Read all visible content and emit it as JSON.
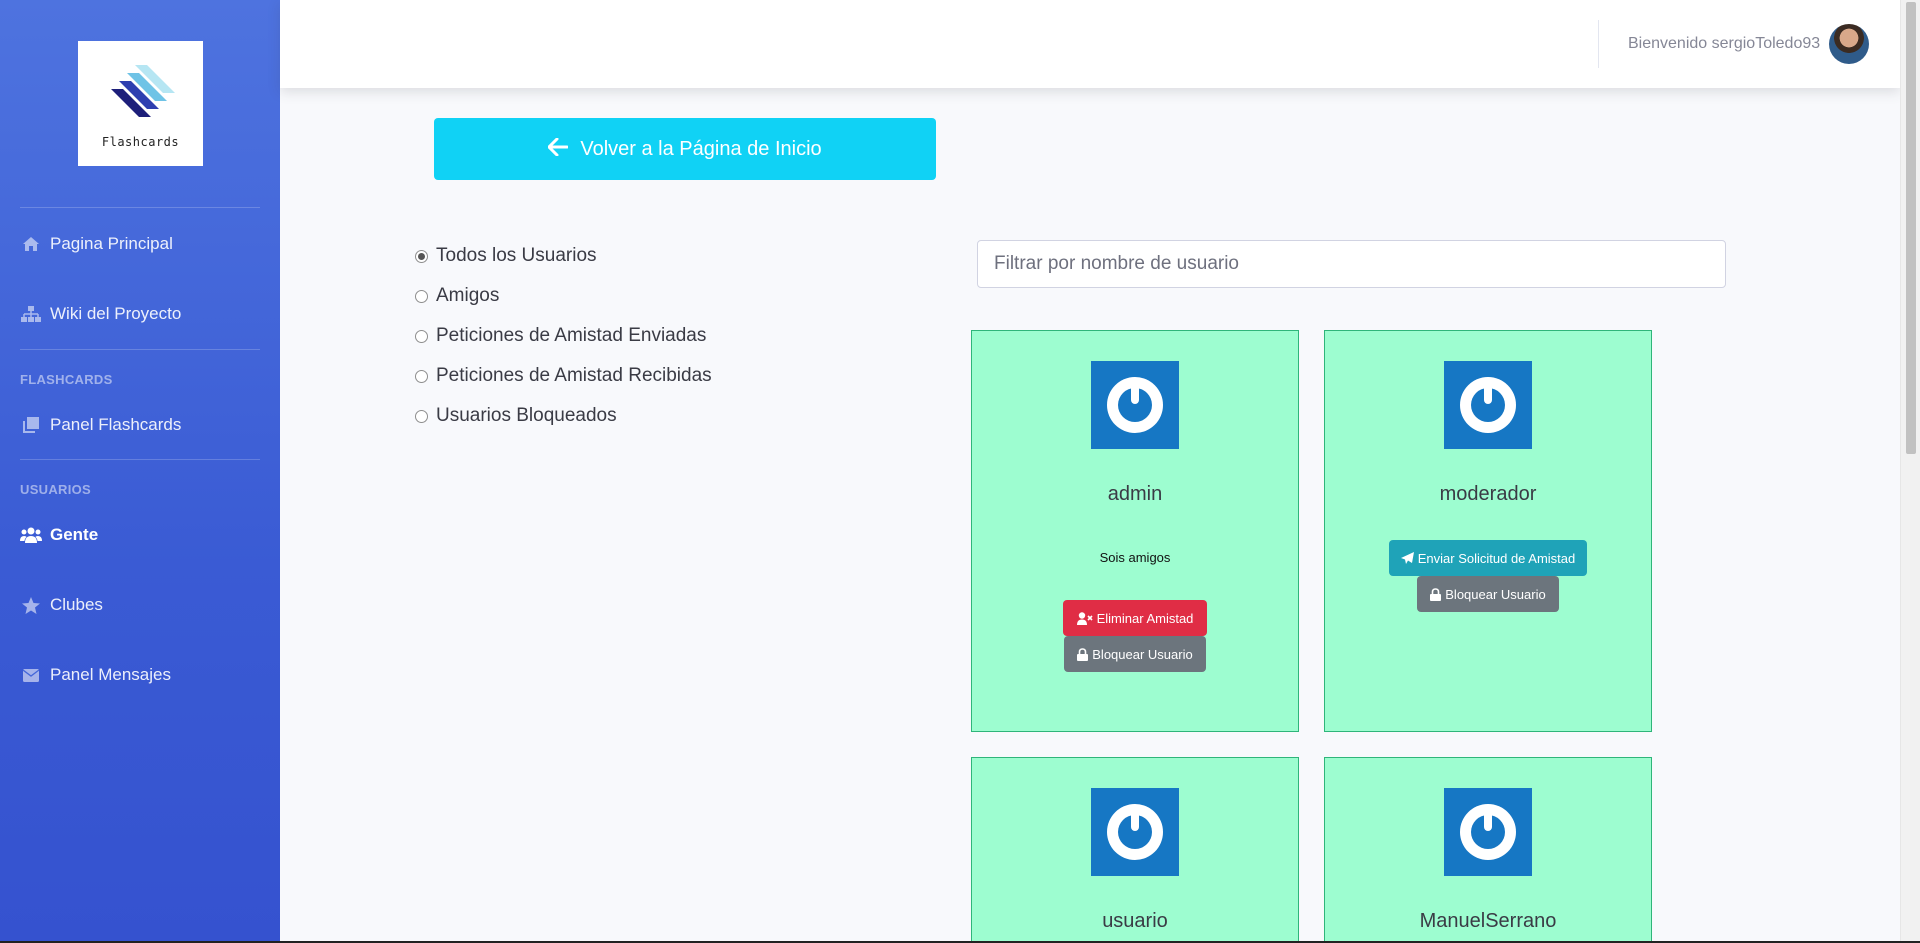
{
  "brand": {
    "name": "Flashcards"
  },
  "sidebar": {
    "items": [
      {
        "label": "Pagina Principal",
        "icon": "home-icon"
      },
      {
        "label": "Wiki del Proyecto",
        "icon": "sitemap-icon"
      },
      {
        "label": "Panel Flashcards",
        "icon": "copy-icon"
      },
      {
        "label": "Gente",
        "icon": "users-icon"
      },
      {
        "label": "Clubes",
        "icon": "star-icon"
      },
      {
        "label": "Panel Mensajes",
        "icon": "envelope-icon"
      }
    ],
    "headings": [
      "FLASHCARDS",
      "USUARIOS"
    ],
    "active": "Gente"
  },
  "topbar": {
    "welcome": "Bienvenido sergioToledo93"
  },
  "back_button": {
    "label": "Volver a la Página de Inicio"
  },
  "filters": {
    "options": [
      "Todos los Usuarios",
      "Amigos",
      "Peticiones de Amistad Enviadas",
      "Peticiones de Amistad Recibidas",
      "Usuarios Bloqueados"
    ],
    "selected": "Todos los Usuarios"
  },
  "search": {
    "placeholder": "Filtrar por nombre de usuario",
    "value": ""
  },
  "users": [
    {
      "name": "admin",
      "status": "Sois amigos",
      "actions": [
        "Eliminar Amistad",
        "Bloquear Usuario"
      ]
    },
    {
      "name": "moderador",
      "status": "",
      "actions": [
        "Enviar Solicitud de Amistad",
        "Bloquear Usuario"
      ]
    },
    {
      "name": "usuario"
    },
    {
      "name": "ManuelSerrano"
    }
  ],
  "colors": {
    "sidebar": "#4e73df",
    "back_button": "#10d2f5",
    "card": "#9dfdd0",
    "card_border": "#2fb57a",
    "danger": "#e02d45",
    "secondary": "#6c757d",
    "info": "#1fa3b8",
    "avatar_bg": "#1677c4"
  }
}
